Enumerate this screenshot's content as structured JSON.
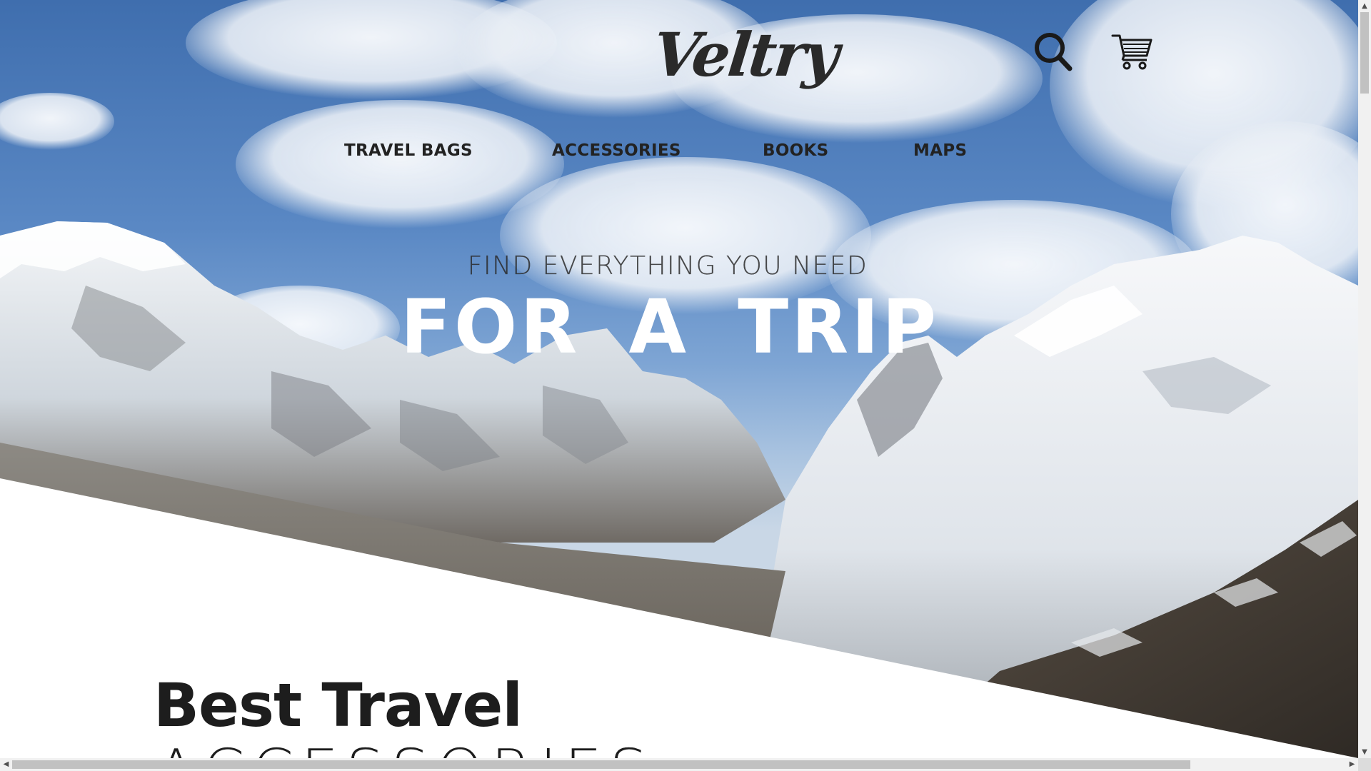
{
  "header": {
    "logo_text": "Veltry",
    "search_icon": "search-icon",
    "cart_icon": "shopping-cart-icon"
  },
  "nav": {
    "items": [
      {
        "label": "TRAVEL BAGS"
      },
      {
        "label": "ACCESSORIES"
      },
      {
        "label": "BOOKS"
      },
      {
        "label": "MAPS"
      }
    ]
  },
  "hero": {
    "subtitle": "FIND EVERYTHING YOU NEED",
    "title": "FOR A TRIP",
    "background": "snowy-mountains-photo"
  },
  "section": {
    "heading": "Best Travel",
    "subheading": "ACCESSORIES"
  },
  "colors": {
    "text_dark": "#222222",
    "hero_title": "#ffffff",
    "page_background": "#ffffff"
  },
  "scrollbars": {
    "vertical_up": "▲",
    "vertical_down": "▼",
    "horizontal_left": "◀",
    "horizontal_right": "▶"
  }
}
